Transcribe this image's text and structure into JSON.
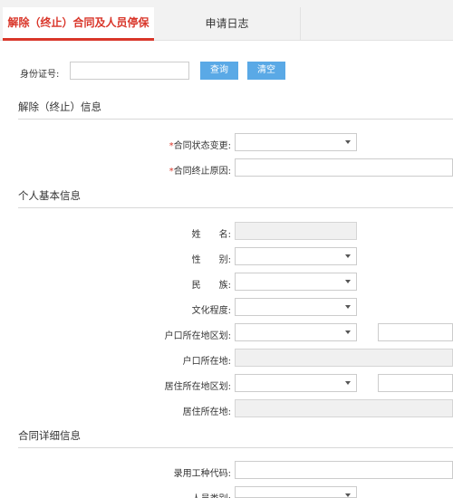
{
  "tabs": [
    {
      "label": "解除（终止）合同及人员停保",
      "active": true
    },
    {
      "label": "申请日志",
      "active": false
    }
  ],
  "search": {
    "id_label": "身份证号:",
    "id_value": "",
    "query_button": "查询",
    "clear_button": "清空"
  },
  "section_termination": {
    "title": "解除（终止）信息",
    "status_change_label": "合同状态变更:",
    "termination_reason_label": "合同终止原因:",
    "required_mark": "*"
  },
  "section_personal": {
    "title": "个人基本信息",
    "name_label": "姓　　名:",
    "gender_label": "性　　别:",
    "ethnicity_label": "民　　族:",
    "education_label": "文化程度:",
    "hukou_region_label": "户口所在地区划:",
    "hukou_address_label": "户口所在地:",
    "residence_region_label": "居住所在地区划:",
    "residence_address_label": "居住所在地:"
  },
  "section_contract": {
    "title": "合同详细信息",
    "job_code_label": "录用工种代码:",
    "person_category_label": "人员类别:"
  },
  "colors": {
    "accent_red": "#d9362a",
    "button_blue": "#5aa9e6"
  }
}
